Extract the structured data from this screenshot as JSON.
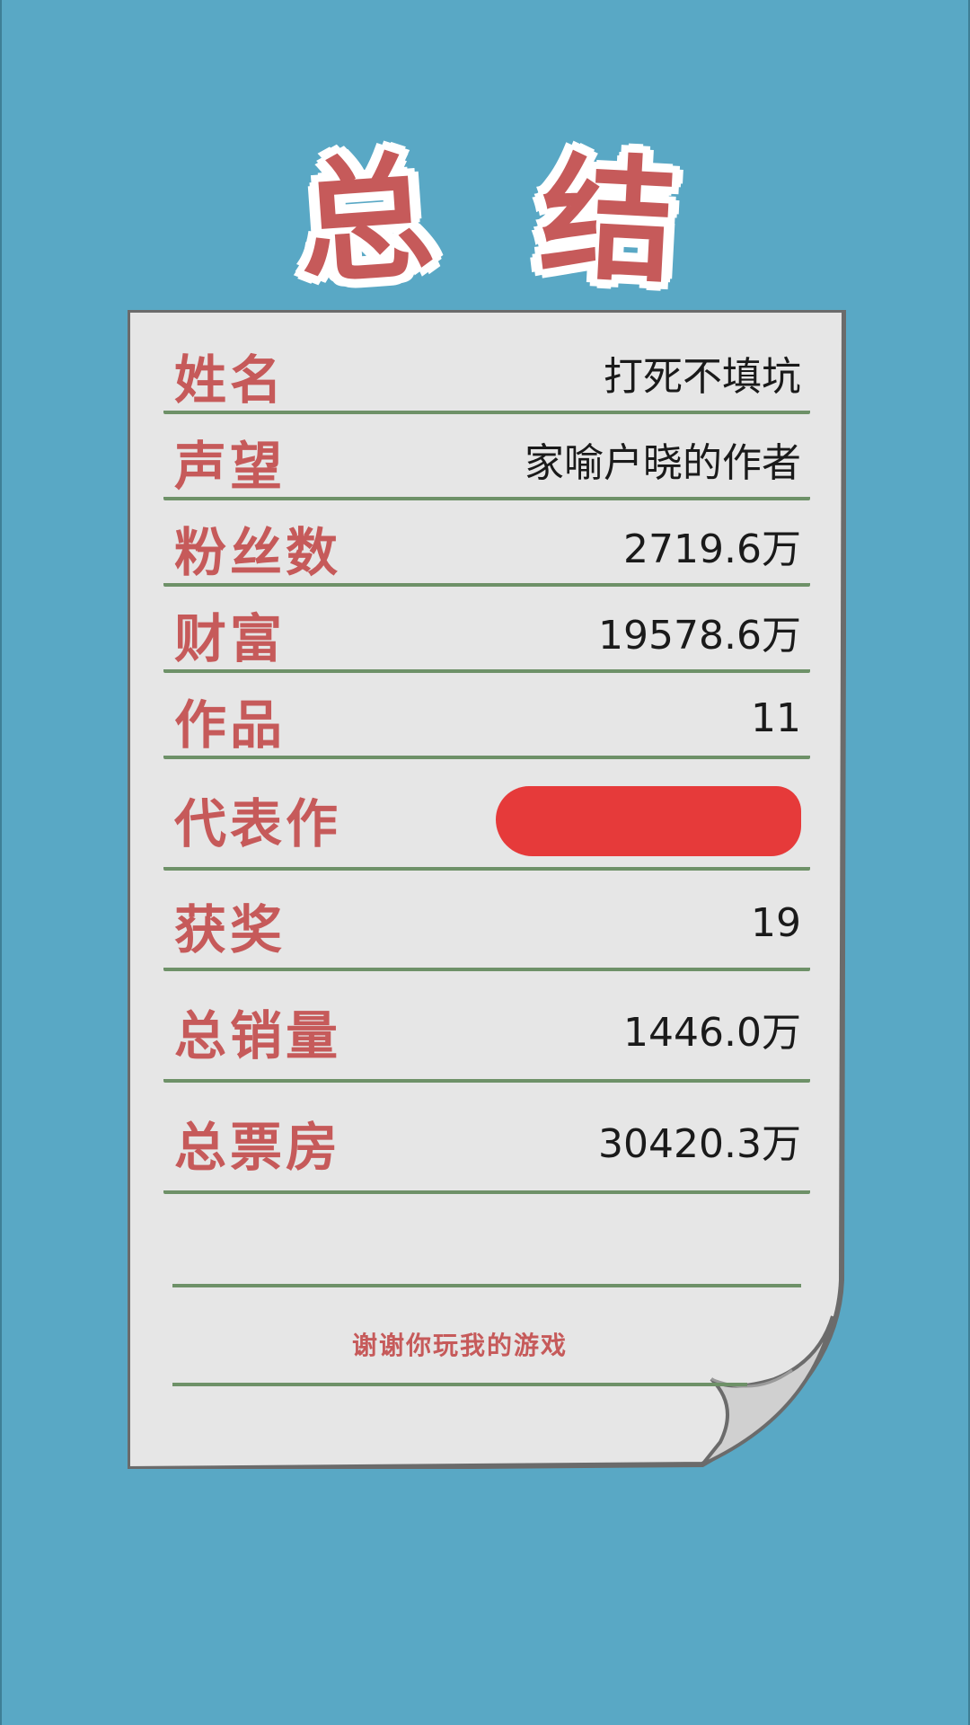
{
  "title": [
    "总",
    "结"
  ],
  "summary": {
    "rows": [
      {
        "label": "姓名",
        "value": "打死不填坑"
      },
      {
        "label": "声望",
        "value": "家喻户晓的作者"
      },
      {
        "label": "粉丝数",
        "value": "2719.6万"
      },
      {
        "label": "财富",
        "value": "19578.6万"
      },
      {
        "label": "作品",
        "value": "11"
      },
      {
        "label": "代表作",
        "value": ""
      },
      {
        "label": "获奖",
        "value": "19"
      },
      {
        "label": "总销量",
        "value": "1446.0万"
      },
      {
        "label": "总票房",
        "value": "30420.3万"
      }
    ]
  },
  "footer": {
    "thanks": "谢谢你玩我的游戏"
  },
  "colors": {
    "background": "#59a8c5",
    "paper": "#e6e6e6",
    "label": "#c65a5a",
    "rule": "#6e9168",
    "redaction": "#e63a3a"
  }
}
